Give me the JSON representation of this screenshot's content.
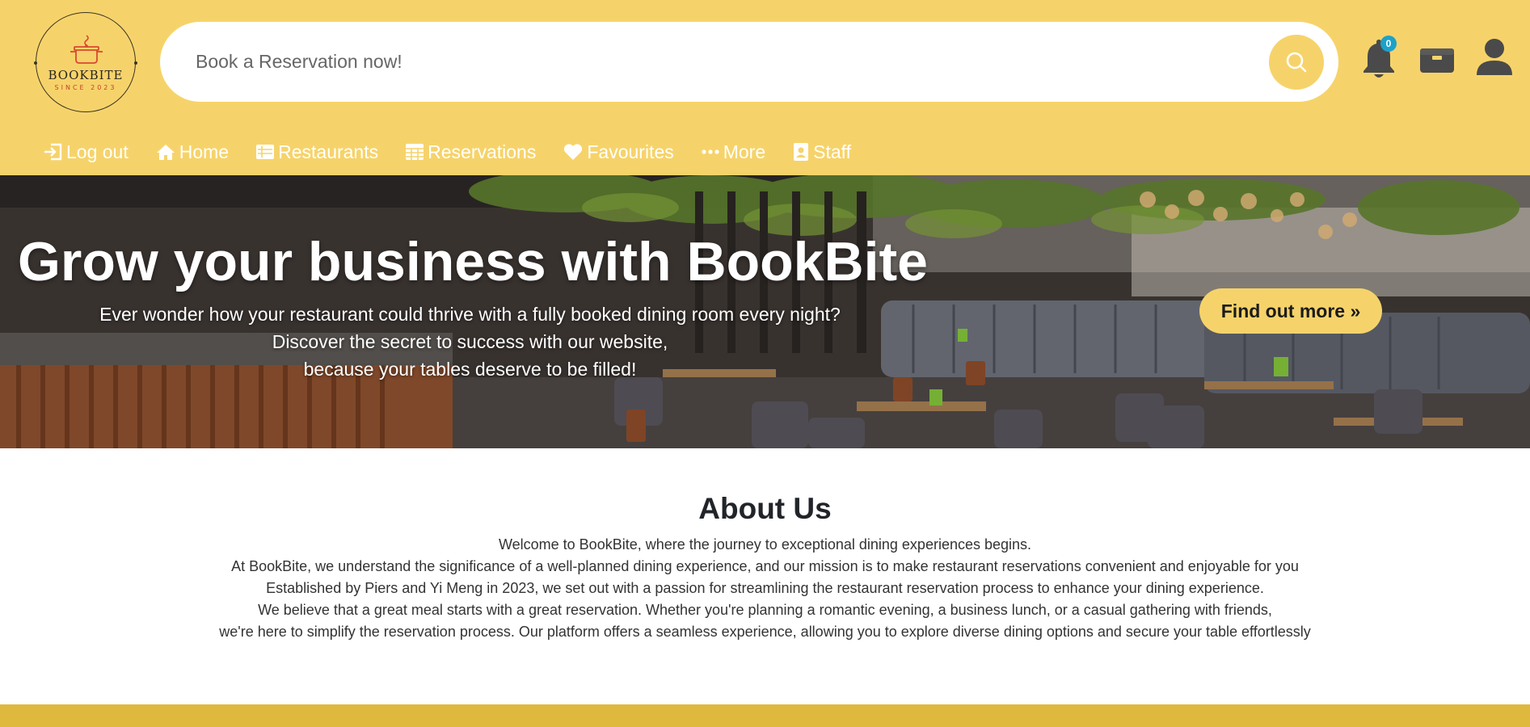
{
  "brand": {
    "name": "BOOKBITE",
    "tagline": "SINCE 2023",
    "primary_color": "#f6d36a",
    "footer_color": "#dfb83e",
    "badge_color": "#1da1c9"
  },
  "search": {
    "placeholder": "Book a Reservation now!",
    "value": "",
    "button_icon": "search-icon"
  },
  "header_icons": {
    "notifications": {
      "icon": "bell-icon",
      "count": "0"
    },
    "wallet": {
      "icon": "wallet-icon"
    },
    "profile": {
      "icon": "user-icon"
    }
  },
  "nav": {
    "items": [
      {
        "label": "Log out",
        "icon": "logout-icon"
      },
      {
        "label": "Home",
        "icon": "home-icon"
      },
      {
        "label": "Restaurants",
        "icon": "list-icon"
      },
      {
        "label": "Reservations",
        "icon": "calendar-icon"
      },
      {
        "label": "Favourites",
        "icon": "heart-icon"
      },
      {
        "label": "More",
        "icon": "ellipsis-icon"
      },
      {
        "label": "Staff",
        "icon": "id-badge-icon"
      }
    ]
  },
  "hero": {
    "title": "Grow your business with BookBite",
    "lines": [
      "Ever wonder how your restaurant could thrive with a fully booked dining room every night?",
      "Discover the secret to success with our website,",
      "because your tables deserve to be filled!"
    ],
    "cta_label": "Find out more »"
  },
  "about": {
    "title": "About Us",
    "lines": [
      "Welcome to BookBite, where the journey to exceptional dining experiences begins.",
      "At BookBite, we understand the significance of a well-planned dining experience, and our mission is to make restaurant reservations convenient and enjoyable for you",
      "Established by Piers and Yi Meng in 2023, we set out with a passion for streamlining the restaurant reservation process to enhance your dining experience.",
      "We believe that a great meal starts with a great reservation. Whether you're planning a romantic evening, a business lunch, or a casual gathering with friends,",
      "we're here to simplify the reservation process. Our platform offers a seamless experience, allowing you to explore diverse dining options and secure your table effortlessly"
    ]
  }
}
